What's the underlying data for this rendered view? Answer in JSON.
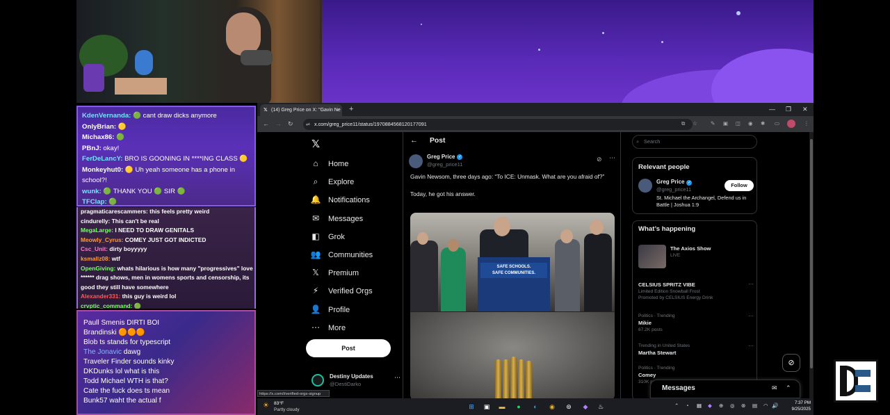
{
  "chat_top": [
    {
      "user": "KdenVernanda:",
      "color": "#7ae0ff",
      "msg": " 🟢 cant draw dicks anymore"
    },
    {
      "user": "OnlyBrian:",
      "color": "#ffffff",
      "msg": " 🟡"
    },
    {
      "user": "Michax86:",
      "color": "#ffffff",
      "msg": " 🟢"
    },
    {
      "user": "PBnJ:",
      "color": "#ffffff",
      "msg": " okay!"
    },
    {
      "user": "FerDeLancY:",
      "color": "#7ae0ff",
      "msg": " BRO IS GOONING IN ****ING CLASS 🟡"
    },
    {
      "user": "Monkeyhut0:",
      "color": "#ffffff",
      "msg": " 🟡 Uh yeah someone has a phone in"
    },
    {
      "user": "",
      "color": "#ffffff",
      "msg": "school?!"
    },
    {
      "user": "wunk:",
      "color": "#7ae0ff",
      "msg": " 🟢 THANK YOU 🟢 SIR 🟢"
    },
    {
      "user": "TFClap:",
      "color": "#7ae0ff",
      "msg": " 🟢"
    }
  ],
  "chat_mid": [
    {
      "user": "pragmaticarescammers:",
      "color": "#ffffff",
      "msg": " this feels pretty weird"
    },
    {
      "user": "cindurelly:",
      "color": "#ffffff",
      "msg": " This can't be real"
    },
    {
      "user": "MegaLarge:",
      "color": "#7aff6a",
      "msg": " I NEED TO DRAW GENITALS"
    },
    {
      "user": "Meowly_Cyrus:",
      "color": "#ff9a3a",
      "msg": " COMEY JUST GOT INDICTED"
    },
    {
      "user": "Csc_Unit:",
      "color": "#ff7ad0",
      "msg": " dirty boyyyyy"
    },
    {
      "user": "ksmallz08:",
      "color": "#ff9a3a",
      "msg": " wtf"
    },
    {
      "user": "OpenGiving:",
      "color": "#7aff6a",
      "msg": " whats hilarious is how many \"progressives\" love"
    },
    {
      "user": "",
      "color": "#ffffff",
      "msg": "****** drag shows, men in womens sports and censorship, its"
    },
    {
      "user": "",
      "color": "#ffffff",
      "msg": "good they still have somewhere"
    },
    {
      "user": "Alexander331:",
      "color": "#ff5a5a",
      "msg": " this guy is weird lol"
    },
    {
      "user": "crvptic_command:",
      "color": "#7aff6a",
      "msg": " 🟢"
    }
  ],
  "chat_bottom": [
    {
      "user": "Paull Smenis",
      "color": "#ffffff",
      "msg": " DIRTI BOI"
    },
    {
      "user": "Brandinski",
      "color": "#ffffff",
      "msg": " 🟠🟠🟠"
    },
    {
      "user": "Blob",
      "color": "#ffffff",
      "msg": " ts stands for typescript"
    },
    {
      "user": "The Jonavic",
      "color": "#8ab4ff",
      "msg": " dawg"
    },
    {
      "user": "Traveler Finder",
      "color": "#ffffff",
      "msg": " sounds kinky"
    },
    {
      "user": "DKDunks",
      "color": "#ffffff",
      "msg": " lol what is this"
    },
    {
      "user": "Todd Michael",
      "color": "#ffffff",
      "msg": " WTH is that?"
    },
    {
      "user": "Cate",
      "color": "#ffffff",
      "msg": " the fuck does ts mean"
    },
    {
      "user": "Bunk57",
      "color": "#ffffff",
      "msg": " waht the actual f"
    }
  ],
  "browser": {
    "tab_title": "(14) Greg Price on X: \"Gavin Ne",
    "url": "x.com/greg_price11/status/1970884568120177091",
    "new_tab": "+",
    "status_url": "https://x.com/i/verified-orgs-signup"
  },
  "x": {
    "nav": [
      {
        "icon": "⌂",
        "label": "Home",
        "name": "home"
      },
      {
        "icon": "⌕",
        "label": "Explore",
        "name": "explore"
      },
      {
        "icon": "🔔",
        "label": "Notifications",
        "name": "notifications"
      },
      {
        "icon": "✉",
        "label": "Messages",
        "name": "messages"
      },
      {
        "icon": "◧",
        "label": "Grok",
        "name": "grok"
      },
      {
        "icon": "👥",
        "label": "Communities",
        "name": "communities"
      },
      {
        "icon": "𝕏",
        "label": "Premium",
        "name": "premium"
      },
      {
        "icon": "⚡",
        "label": "Verified Orgs",
        "name": "verified-orgs"
      },
      {
        "icon": "👤",
        "label": "Profile",
        "name": "profile"
      },
      {
        "icon": "⋯",
        "label": "More",
        "name": "more"
      }
    ],
    "post_button": "Post",
    "account": {
      "name": "Destiny Updates",
      "handle": "@DestiDarko"
    },
    "header_title": "Post",
    "author": {
      "name": "Greg Price",
      "handle": "@greg_price11"
    },
    "tweet_line1": "Gavin Newsom, three days ago: “To ICE: Unmask. What are you afraid of?”",
    "tweet_line2": "Today, he got his answer.",
    "sign_text": "SAFE SCHOOLS.\nSAFE COMMUNITIES.",
    "search_placeholder": "Search",
    "relevant": {
      "title": "Relevant people",
      "name": "Greg Price",
      "handle": "@greg_price11",
      "bio": "St. Michael the Archangel, Defend us in Battle | Joshua 1:9",
      "follow": "Follow"
    },
    "happening": {
      "title": "What’s happening",
      "axios_title": "The Axios Show",
      "axios_sub": "LIVE",
      "ad_title": "CELSIUS SPRITZ VIBE",
      "ad_sub": "Limited Edition Snowball Frost",
      "ad_promo": "Promoted by CELSIUS Energy Drink",
      "t1_ctx": "Politics · Trending",
      "t1_name": "Mikie",
      "t1_count": "67.2K posts",
      "t2_ctx": "Trending in United States",
      "t2_name": "Martha Stewart",
      "t3_ctx": "Politics · Trending",
      "t3_name": "Comey",
      "t3_count": "310K po"
    },
    "messages": "Messages"
  },
  "taskbar": {
    "temp": "83°F",
    "cond": "Partly cloudy",
    "time": "7:37 PM",
    "date": "9/25/2025"
  }
}
